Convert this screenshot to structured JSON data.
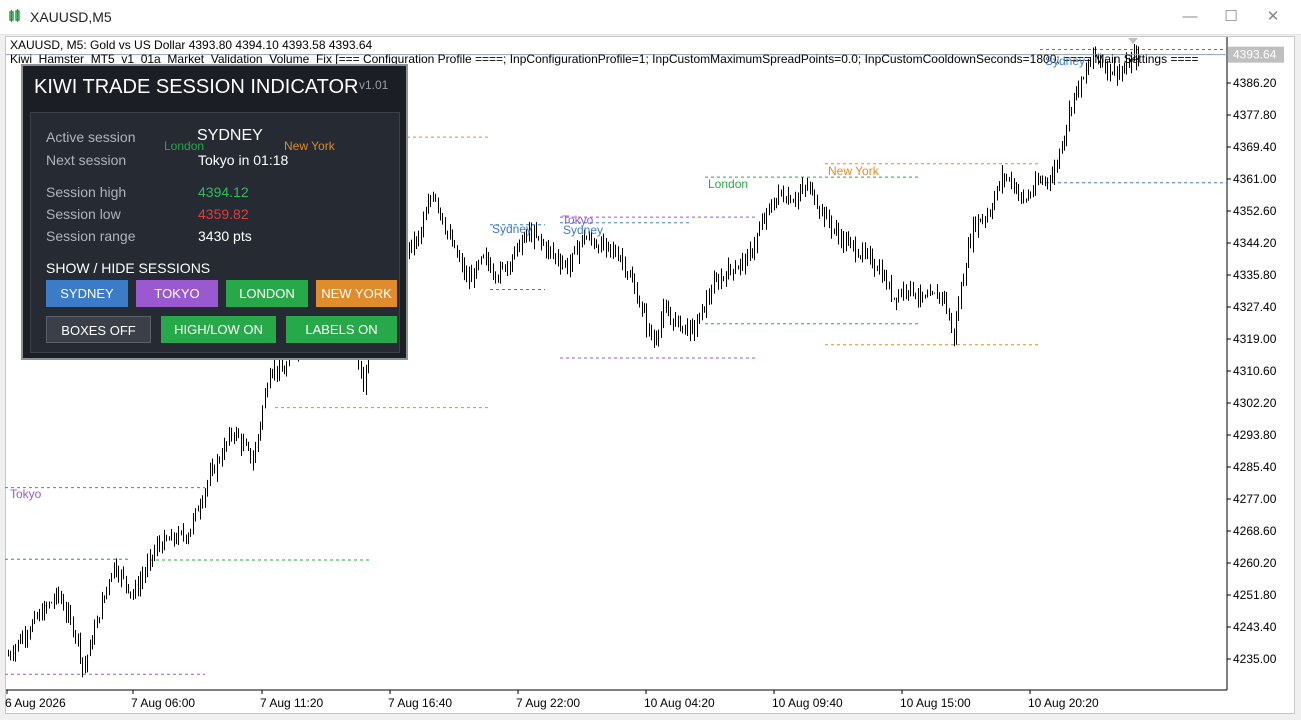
{
  "window": {
    "title": "XAUUSD,M5",
    "minimize_glyph": "—",
    "maximize_glyph": "☐",
    "close_glyph": "✕"
  },
  "chart_header": {
    "symbol_line": "XAUUSD, M5:  Gold vs US Dollar   4393.80  4394.10  4393.58  4393.64",
    "ea_line": "Kiwi_Hamster_MT5_v1_01a_Market_Validation_Volume_Fix [=== Configuration Profile ====; InpConfigurationProfile=1; InpCustomMaximumSpreadPoints=0.0; InpCustomCooldownSeconds=1800; ==== Main Settings ===="
  },
  "panel": {
    "title": "KIWI TRADE SESSION INDICATOR",
    "version": "v1.01",
    "active_session_label": "Active session",
    "active_session_value": "SYDNEY",
    "next_session_label": "Next session",
    "next_session_value": "Tokyo in 01:18",
    "session_high_label": "Session high",
    "session_high_value": "4394.12",
    "session_low_label": "Session low",
    "session_low_value": "4359.82",
    "session_range_label": "Session range",
    "session_range_value": "3430 pts",
    "show_hide_heading": "SHOW / HIDE SESSIONS",
    "buttons": {
      "sydney": "SYDNEY",
      "tokyo": "TOKYO",
      "london": "LONDON",
      "new_york": "NEW YORK",
      "boxes": "BOXES OFF",
      "high_low": "HIGH/LOW ON",
      "labels": "LABELS ON"
    }
  },
  "colors": {
    "sydney": "#3b7bc8",
    "tokyo": "#9b59d0",
    "london": "#27a849",
    "new_york": "#e08b2c",
    "session_high_text": "#2fbf5a",
    "session_low_text": "#e53b3b",
    "current_price_bg": "#bfbfbf"
  },
  "session_labels": {
    "tokyo_left": "Tokyo",
    "sydney_1": "Sydney",
    "tokyo_1": "Tokyo",
    "sydney_2": "Sydney",
    "london_panel": "London",
    "new_york_panel": "New York",
    "london_2": "London",
    "new_york_2": "New York",
    "sydney_3": "Sydney"
  },
  "chart_data": {
    "type": "candlestick",
    "symbol": "XAUUSD",
    "timeframe": "M5",
    "ylim": [
      4230.0,
      4397.0
    ],
    "y_ticks": [
      "4386.20",
      "4377.80",
      "4369.40",
      "4361.00",
      "4352.60",
      "4344.20",
      "4335.80",
      "4327.40",
      "4319.00",
      "4310.60",
      "4302.20",
      "4293.80",
      "4285.40",
      "4277.00",
      "4268.60",
      "4260.20",
      "4251.80",
      "4243.40",
      "4235.00"
    ],
    "x_labels": [
      "6 Aug 2026",
      "7 Aug 06:00",
      "7 Aug 11:20",
      "7 Aug 16:40",
      "7 Aug 22:00",
      "10 Aug 04:20",
      "10 Aug 09:40",
      "10 Aug 15:00",
      "10 Aug 20:20"
    ],
    "current_price": "4393.64",
    "price_path": [
      [
        0,
        4236
      ],
      [
        20,
        4243
      ],
      [
        50,
        4252
      ],
      [
        70,
        4240
      ],
      [
        75,
        4232
      ],
      [
        90,
        4246
      ],
      [
        105,
        4260
      ],
      [
        125,
        4252
      ],
      [
        150,
        4265
      ],
      [
        180,
        4268
      ],
      [
        200,
        4282
      ],
      [
        225,
        4295
      ],
      [
        245,
        4287
      ],
      [
        262,
        4312
      ],
      [
        275,
        4310
      ],
      [
        290,
        4318
      ],
      [
        305,
        4322
      ],
      [
        320,
        4330
      ],
      [
        340,
        4325
      ],
      [
        355,
        4308
      ],
      [
        365,
        4325
      ],
      [
        385,
        4340
      ],
      [
        410,
        4345
      ],
      [
        425,
        4358
      ],
      [
        440,
        4346
      ],
      [
        460,
        4334
      ],
      [
        475,
        4340
      ],
      [
        490,
        4336
      ],
      [
        505,
        4341
      ],
      [
        520,
        4347
      ],
      [
        530,
        4345
      ],
      [
        545,
        4341
      ],
      [
        560,
        4338
      ],
      [
        575,
        4346
      ],
      [
        595,
        4343
      ],
      [
        612,
        4341
      ],
      [
        625,
        4333
      ],
      [
        645,
        4318
      ],
      [
        655,
        4326
      ],
      [
        670,
        4323
      ],
      [
        685,
        4321
      ],
      [
        705,
        4333
      ],
      [
        720,
        4337
      ],
      [
        740,
        4340
      ],
      [
        755,
        4350
      ],
      [
        770,
        4357
      ],
      [
        785,
        4356
      ],
      [
        800,
        4359
      ],
      [
        815,
        4352
      ],
      [
        830,
        4346
      ],
      [
        850,
        4342
      ],
      [
        870,
        4338
      ],
      [
        885,
        4330
      ],
      [
        900,
        4333
      ],
      [
        915,
        4329
      ],
      [
        935,
        4331
      ],
      [
        945,
        4319
      ],
      [
        955,
        4336
      ],
      [
        965,
        4349
      ],
      [
        980,
        4352
      ],
      [
        995,
        4362
      ],
      [
        1005,
        4360
      ],
      [
        1015,
        4355
      ],
      [
        1030,
        4360
      ],
      [
        1045,
        4362
      ],
      [
        1055,
        4372
      ],
      [
        1065,
        4383
      ],
      [
        1075,
        4387
      ],
      [
        1085,
        4394
      ],
      [
        1100,
        4390
      ],
      [
        1115,
        4389
      ],
      [
        1125,
        4393
      ],
      [
        1140,
        4393.6
      ]
    ],
    "session_lines": [
      {
        "session": "tokyo",
        "price": 4280.0,
        "x": [
          5,
          205
        ]
      },
      {
        "session": "sydney",
        "price": 4261.2,
        "x": [
          5,
          130
        ]
      },
      {
        "session": "tokyo",
        "price": 4231.0,
        "x": [
          5,
          205
        ]
      },
      {
        "session": "london",
        "price": 4261.0,
        "x": [
          150,
          370
        ]
      },
      {
        "session": "new_york",
        "price": 4372.0,
        "x": [
          275,
          490
        ]
      },
      {
        "session": "new_york",
        "price": 4301.0,
        "x": [
          275,
          490
        ]
      },
      {
        "session": "sydney",
        "price": 4349.0,
        "x": [
          490,
          545
        ]
      },
      {
        "session": "sydney",
        "price": 4332.0,
        "x": [
          490,
          545
        ]
      },
      {
        "session": "tokyo",
        "price": 4351.0,
        "x": [
          560,
          755
        ]
      },
      {
        "session": "tokyo",
        "price": 4314.0,
        "x": [
          560,
          755
        ]
      },
      {
        "session": "sydney",
        "price": 4349.5,
        "x": [
          560,
          690
        ]
      },
      {
        "session": "london",
        "price": 4361.5,
        "x": [
          705,
          920
        ]
      },
      {
        "session": "london",
        "price": 4323.0,
        "x": [
          705,
          920
        ]
      },
      {
        "session": "new_york",
        "price": 4365.0,
        "x": [
          825,
          1040
        ]
      },
      {
        "session": "new_york",
        "price": 4317.5,
        "x": [
          825,
          1040
        ]
      },
      {
        "session": "sydney",
        "price": 4395.0,
        "x": [
          1040,
          1227
        ]
      },
      {
        "session": "sydney",
        "price": 4360.0,
        "x": [
          1040,
          1227
        ]
      }
    ]
  }
}
